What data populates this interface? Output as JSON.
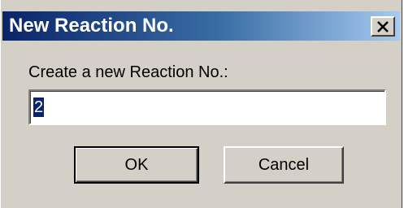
{
  "dialog": {
    "title": "New Reaction No.",
    "close_icon": "close-icon",
    "prompt": "Create a new Reaction No.:",
    "input_value": "2",
    "ok_label": "OK",
    "cancel_label": "Cancel"
  }
}
